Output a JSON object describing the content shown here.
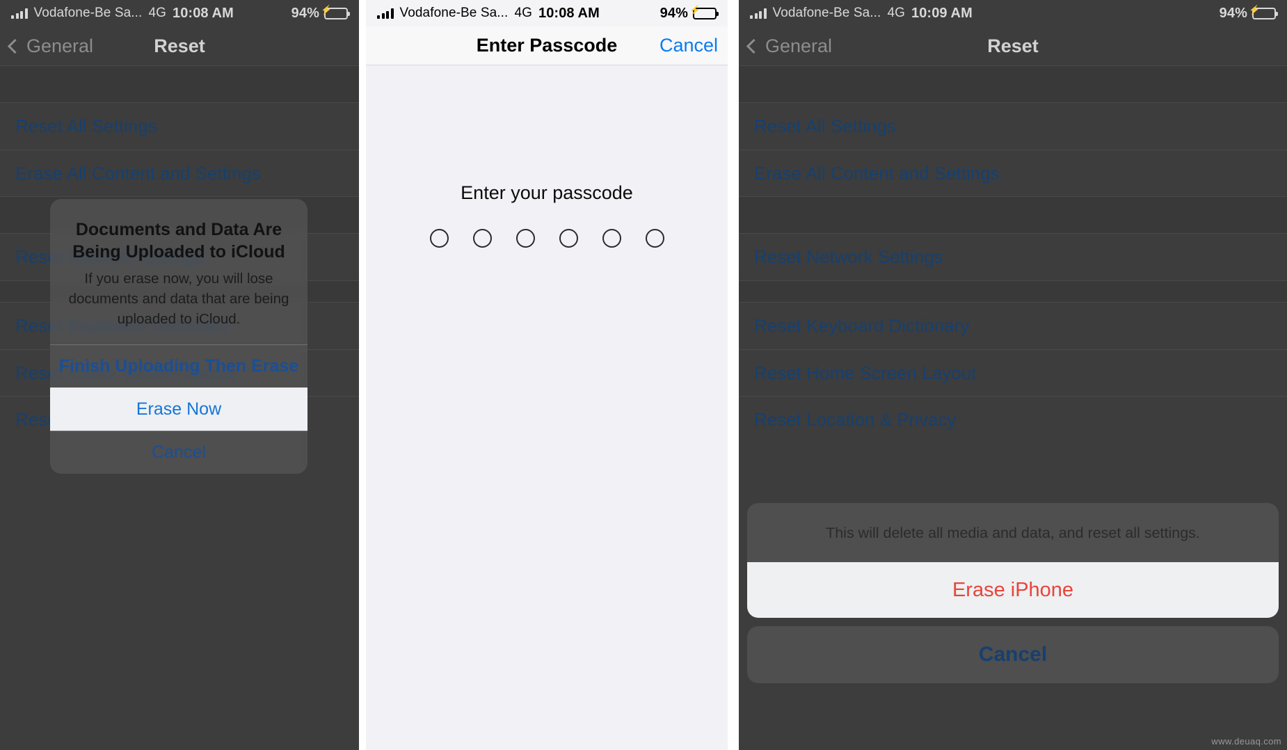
{
  "panels": [
    {
      "status": {
        "carrier": "Vodafone-Be Sa...",
        "network": "4G",
        "time": "10:08 AM",
        "battery": "94%",
        "charging_icon": "lightning-bolt-icon",
        "signal_icon": "signal-bars-icon",
        "battery_icon": "battery-icon"
      },
      "nav": {
        "back": "General",
        "title": "Reset"
      },
      "rows": [
        "Reset All Settings",
        "Erase All Content and Settings",
        "Reset Network Settings",
        "Reset Keyboard Dictionary",
        "Reset Home Screen Layout",
        "Reset Location & Privacy"
      ],
      "alert": {
        "title": "Documents and Data Are Being Uploaded to iCloud",
        "message": "If you erase now, you will lose documents and data that are being uploaded to iCloud.",
        "buttons": [
          {
            "label": "Finish Uploading Then Erase",
            "style": "bold"
          },
          {
            "label": "Erase Now",
            "style": "highlight"
          },
          {
            "label": "Cancel",
            "style": "plain"
          }
        ]
      }
    },
    {
      "status": {
        "carrier": "Vodafone-Be Sa...",
        "network": "4G",
        "time": "10:08 AM",
        "battery": "94%",
        "charging_icon": "lightning-bolt-icon",
        "signal_icon": "signal-bars-icon",
        "battery_icon": "battery-icon"
      },
      "nav": {
        "title": "Enter Passcode",
        "action": "Cancel"
      },
      "passcode": {
        "prompt": "Enter your passcode",
        "dot_count": 6,
        "filled": 0
      }
    },
    {
      "status": {
        "carrier": "Vodafone-Be Sa...",
        "network": "4G",
        "time": "10:09 AM",
        "battery": "94%",
        "charging_icon": "lightning-bolt-icon",
        "signal_icon": "signal-bars-icon",
        "battery_icon": "battery-icon"
      },
      "nav": {
        "back": "General",
        "title": "Reset"
      },
      "rows": [
        "Reset All Settings",
        "Erase All Content and Settings",
        "Reset Network Settings",
        "Reset Keyboard Dictionary",
        "Reset Home Screen Layout",
        "Reset Location & Privacy"
      ],
      "sheet": {
        "message": "This will delete all media and data, and reset all settings.",
        "confirm": "Erase iPhone",
        "cancel": "Cancel"
      }
    }
  ],
  "watermark": "www.deuaq.com",
  "colors": {
    "accent_blue": "#0a7bf0",
    "link_dim": "#16406f",
    "destructive_red": "#e8443a",
    "battery_green": "#34c759",
    "dim_bg": "#3d3d3d",
    "light_bg": "#f2f2f6"
  }
}
